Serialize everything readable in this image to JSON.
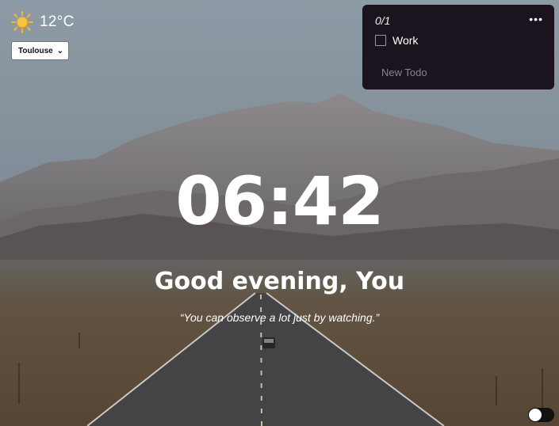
{
  "weather": {
    "temperature": "12°C",
    "icon": "sun-icon",
    "selected_city": "Toulouse"
  },
  "todo": {
    "count": "0/1",
    "items": [
      {
        "label": "Work",
        "done": false
      }
    ],
    "new_placeholder": "New Todo"
  },
  "clock": {
    "time": "06:42"
  },
  "greeting": "Good evening, You",
  "quote": "“You can observe a lot just by watching.”",
  "theme_toggle": {
    "state": "light"
  },
  "colors": {
    "todo_panel_bg": "#1b141e",
    "sky": "#8ea0ad",
    "road": "#4a4a4c"
  }
}
